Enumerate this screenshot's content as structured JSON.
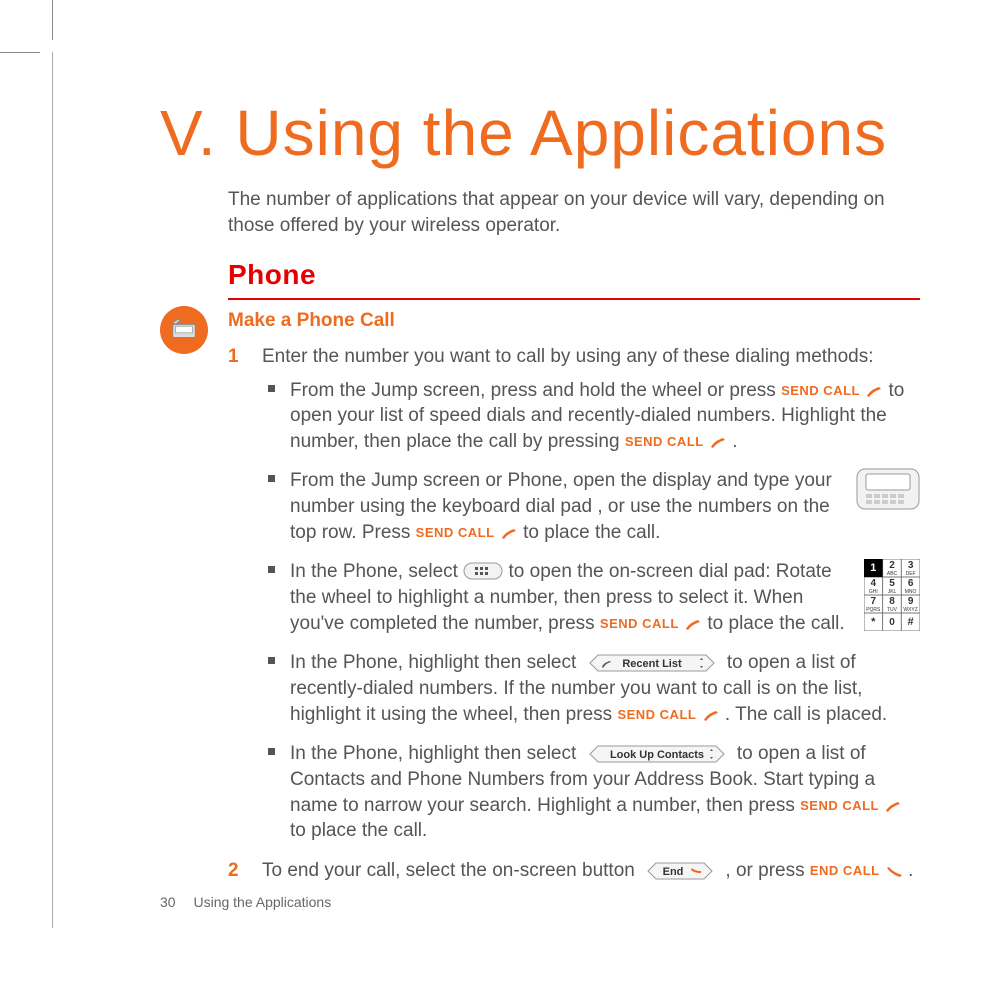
{
  "chapter_title": "V. Using the Applications",
  "intro": "The number of applications that appear on your device will vary, depending on those offered by your wireless operator.",
  "section_heading": "Phone",
  "subheading": "Make a Phone Call",
  "labels": {
    "send_call": "SEND CALL",
    "end_call": "END CALL"
  },
  "buttons": {
    "recent_list": "Recent List",
    "look_up_contacts": "Look Up Contacts",
    "end": "End"
  },
  "steps": {
    "step1_intro": "Enter the number you want to call by using any of these dialing methods:",
    "bullets": {
      "b1": {
        "p1": "From the Jump screen, press and hold the wheel or press ",
        "p2": " to open your list of speed dials and recently-dialed numbers. Highlight the number, then place the call by pressing ",
        "p3": " ."
      },
      "b2": {
        "p1": "From the Jump screen or Phone, open the display and type your number using the keyboard dial pad ",
        "p2": ", or use the numbers on the top row. Press ",
        "p3": " to place the call."
      },
      "b3": {
        "p1": "In the Phone, select ",
        "p2": " to open the on-screen dial pad: Rotate the wheel to highlight a number, then press to select it. When you've completed the number, press ",
        "p3": " to place the call."
      },
      "b4": {
        "p1": "In the Phone, highlight then select ",
        "p2": " to open a list of recently-dialed numbers. If the number you want to call is on the list, highlight it using the wheel, then press ",
        "p3": ". The call is placed."
      },
      "b5": {
        "p1": "In the Phone, highlight then select ",
        "p2": " to open a list of Contacts and  Phone Numbers from your Address Book. Start typing a name to narrow your search. Highlight a number, then press ",
        "p3": " to place the call."
      }
    },
    "step2": {
      "p1": "To end your call, select the on-screen button ",
      "p2": ", or press ",
      "p3": " ."
    }
  },
  "footer": {
    "page_number": "30",
    "doc_title": "Using the Applications"
  }
}
